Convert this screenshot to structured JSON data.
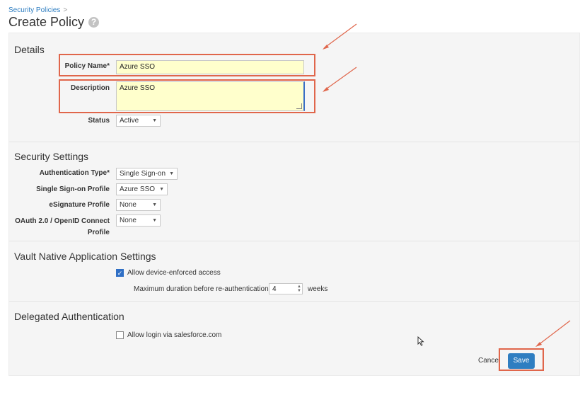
{
  "breadcrumb": {
    "parent": "Security Policies",
    "separator": ">"
  },
  "page": {
    "title": "Create Policy",
    "help_icon": "?"
  },
  "details": {
    "heading": "Details",
    "policy_name_label": "Policy Name*",
    "policy_name_value": "Azure SSO",
    "description_label": "Description",
    "description_value": "Azure SSO",
    "status_label": "Status",
    "status_value": "Active"
  },
  "security": {
    "heading": "Security Settings",
    "auth_type_label": "Authentication Type*",
    "auth_type_value": "Single Sign-on",
    "sso_profile_label": "Single Sign-on Profile",
    "sso_profile_value": "Azure SSO",
    "esig_label": "eSignature Profile",
    "esig_value": "None",
    "oauth_label_line1": "OAuth 2.0 / OpenID Connect",
    "oauth_label_line2": "Profile",
    "oauth_value": "None"
  },
  "vault": {
    "heading": "Vault Native Application Settings",
    "device_access_label": "Allow device-enforced access",
    "device_access_checked": true,
    "max_duration_label": "Maximum duration before re-authentication",
    "max_duration_value": "4",
    "max_duration_unit": "weeks"
  },
  "delegated": {
    "heading": "Delegated Authentication",
    "salesforce_label": "Allow login via salesforce.com",
    "salesforce_checked": false
  },
  "actions": {
    "cancel_label": "Cancel",
    "save_label": "Save"
  },
  "colors": {
    "accent": "#2f7ec1",
    "annotation": "#e0664b",
    "input_highlight": "#ffffcc"
  },
  "icons": {
    "help": "help-icon",
    "dropdown": "chevron-down-icon",
    "check": "checkmark-icon"
  }
}
